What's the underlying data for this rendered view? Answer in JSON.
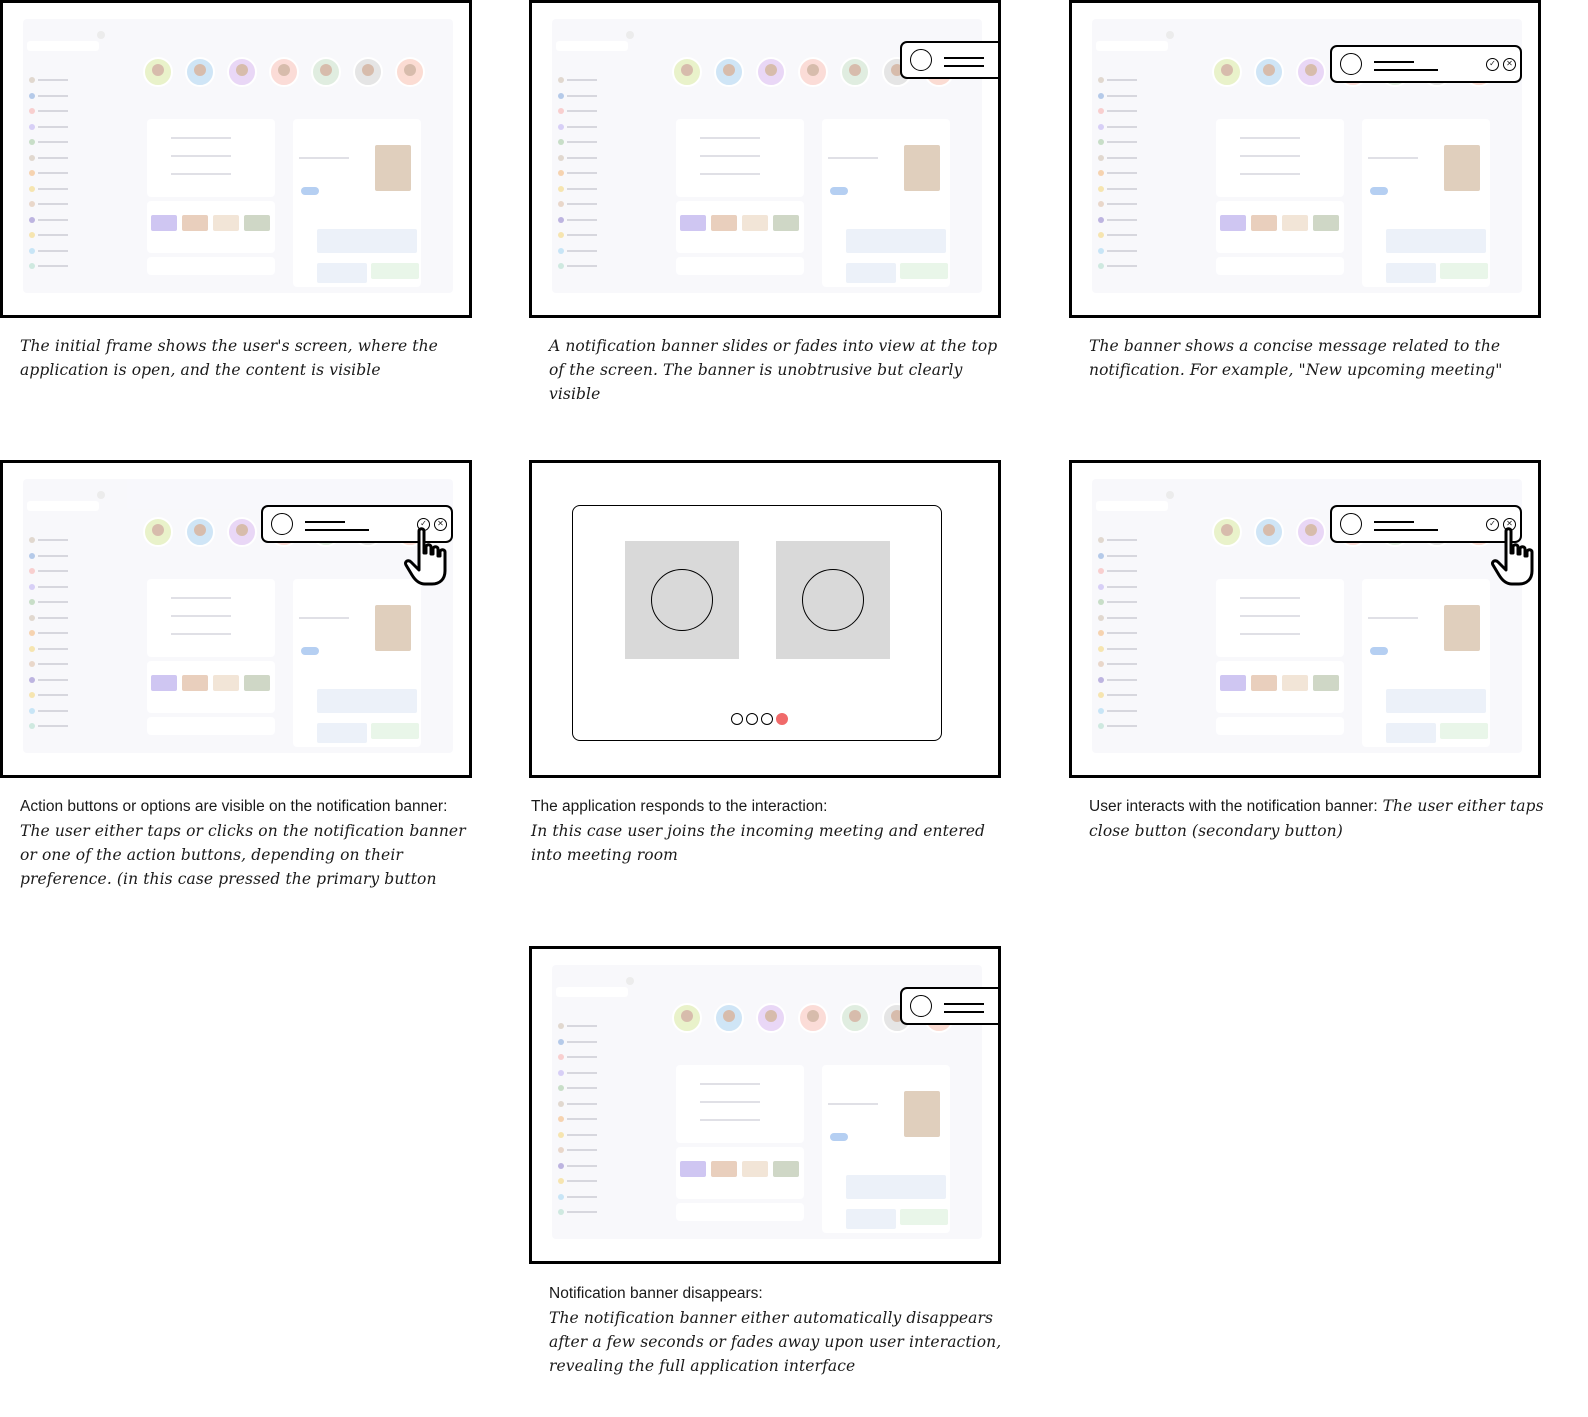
{
  "captions": [
    {
      "lead": "",
      "hand": "The initial frame shows the user's screen, where the application is open, and the content is visible"
    },
    {
      "lead": "",
      "hand": "A notification banner slides or fades into view at the top of the screen. The banner is unobtrusive but clearly visible"
    },
    {
      "lead": "",
      "hand": "The banner shows a concise message related to the notification. For example, \"New upcoming meeting\""
    },
    {
      "lead": "Action buttons or options are visible on the notification banner:",
      "hand": "The user either taps or clicks on the notification banner or one of the action buttons, depending on their preference. (in this case pressed the primary button"
    },
    {
      "lead": "The application responds to the interaction:",
      "hand": "In this case user joins the incoming meeting and entered into meeting room"
    },
    {
      "lead": "User interacts with the notification banner:",
      "hand": "The user either taps close button (secondary button)"
    },
    {
      "lead": "Notification banner disappears:",
      "hand": "The notification banner either automatically disappears after a few seconds or fades away upon user interaction, revealing the full application interface"
    }
  ],
  "icons": {
    "primary_action": "check-circle-icon",
    "secondary_action": "close-circle-icon",
    "cursor": "hand-pointer-icon"
  },
  "colors": {
    "frame_border": "#000000",
    "video_placeholder": "#d9d9d9",
    "active_dot": "#f06a6a"
  },
  "meeting_room": {
    "dot_count": 4,
    "active_dot_index": 3
  }
}
